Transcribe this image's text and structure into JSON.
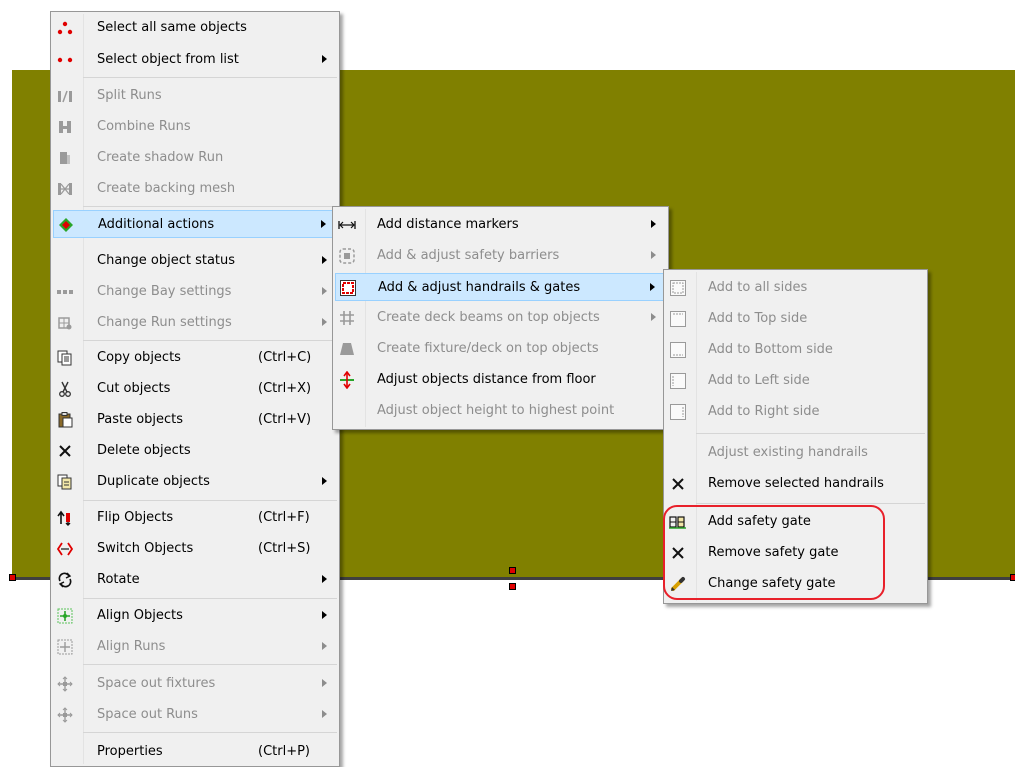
{
  "canvas": {
    "fill_color": "#808000",
    "edge_color": "#3f3f3f",
    "handle_color": "#e00000"
  },
  "highlight": {
    "background": "#cce8ff",
    "border": "#99d1ff"
  },
  "annotation": {
    "color": "#e8202a"
  },
  "context_menu": {
    "items": [
      {
        "label": "Select all same objects",
        "icon": "red-dots-icon",
        "enabled": true
      },
      {
        "label": "Select object from list",
        "icon": "red-dots-pair-icon",
        "enabled": true,
        "submenu": true
      },
      {
        "label": "Split Runs",
        "icon": "split-runs-icon",
        "enabled": false
      },
      {
        "label": "Combine Runs",
        "icon": "combine-runs-icon",
        "enabled": false
      },
      {
        "label": "Create shadow Run",
        "icon": "shadow-run-icon",
        "enabled": false
      },
      {
        "label": "Create backing mesh",
        "icon": "backing-mesh-icon",
        "enabled": false
      },
      {
        "label": "Additional actions",
        "icon": "additional-actions-icon",
        "enabled": true,
        "submenu": true,
        "highlighted": true
      },
      {
        "label": "Change object status",
        "icon": "",
        "enabled": true,
        "submenu": true
      },
      {
        "label": "Change Bay settings",
        "icon": "bay-settings-icon",
        "enabled": false,
        "submenu": true
      },
      {
        "label": "Change Run settings",
        "icon": "run-settings-icon",
        "enabled": false,
        "submenu": true
      },
      {
        "label": "Copy objects",
        "shortcut": "(Ctrl+C)",
        "icon": "copy-icon",
        "enabled": true
      },
      {
        "label": "Cut objects",
        "shortcut": "(Ctrl+X)",
        "icon": "scissors-icon",
        "enabled": true
      },
      {
        "label": "Paste objects",
        "shortcut": "(Ctrl+V)",
        "icon": "paste-icon",
        "enabled": true
      },
      {
        "label": "Delete objects",
        "icon": "x-icon",
        "enabled": true
      },
      {
        "label": "Duplicate objects",
        "icon": "duplicate-icon",
        "enabled": true,
        "submenu": true
      },
      {
        "label": "Flip Objects",
        "shortcut": "(Ctrl+F)",
        "icon": "flip-icon",
        "enabled": true
      },
      {
        "label": "Switch Objects",
        "shortcut": "(Ctrl+S)",
        "icon": "switch-icon",
        "enabled": true
      },
      {
        "label": "Rotate",
        "icon": "rotate-icon",
        "enabled": true,
        "submenu": true
      },
      {
        "label": "Align Objects",
        "icon": "align-objects-icon",
        "enabled": true,
        "submenu": true
      },
      {
        "label": "Align Runs",
        "icon": "align-runs-icon",
        "enabled": false,
        "submenu": true
      },
      {
        "label": "Space out fixtures",
        "icon": "move-arrows-icon",
        "enabled": false,
        "submenu": true
      },
      {
        "label": "Space out Runs",
        "icon": "move-arrows-icon",
        "enabled": false,
        "submenu": true
      },
      {
        "label": "Properties",
        "shortcut": "(Ctrl+P)",
        "icon": "",
        "enabled": true
      }
    ]
  },
  "additional_actions_menu": {
    "items": [
      {
        "label": "Add distance markers",
        "icon": "distance-marker-icon",
        "enabled": true,
        "submenu": true
      },
      {
        "label": "Add & adjust safety barriers",
        "icon": "safety-barrier-icon",
        "enabled": false,
        "submenu": true
      },
      {
        "label": "Add & adjust handrails & gates",
        "icon": "handrail-icon",
        "enabled": true,
        "submenu": true,
        "highlighted": true
      },
      {
        "label": "Create deck beams on top objects",
        "icon": "grid-icon",
        "enabled": false,
        "submenu": true
      },
      {
        "label": "Create fixture/deck on top objects",
        "icon": "deck-icon",
        "enabled": false
      },
      {
        "label": "Adjust objects distance from floor",
        "icon": "vertical-adjust-icon",
        "enabled": true
      },
      {
        "label": "Adjust object height to highest point",
        "icon": "",
        "enabled": false
      }
    ]
  },
  "handrails_menu": {
    "items": [
      {
        "label": "Add to all sides",
        "icon": "all-sides-icon",
        "enabled": false
      },
      {
        "label": "Add to Top side",
        "icon": "top-side-icon",
        "enabled": false
      },
      {
        "label": "Add to Bottom side",
        "icon": "bottom-side-icon",
        "enabled": false
      },
      {
        "label": "Add to Left side",
        "icon": "left-side-icon",
        "enabled": false
      },
      {
        "label": "Add to Right side",
        "icon": "right-side-icon",
        "enabled": false
      },
      {
        "label": "Adjust existing handrails",
        "icon": "",
        "enabled": false
      },
      {
        "label": "Remove selected handrails",
        "icon": "x-icon",
        "enabled": true
      },
      {
        "label": "Add safety gate",
        "icon": "safety-gate-icon",
        "enabled": true
      },
      {
        "label": "Remove safety gate",
        "icon": "x-icon",
        "enabled": true
      },
      {
        "label": "Change safety gate",
        "icon": "pencil-icon",
        "enabled": true
      }
    ]
  }
}
